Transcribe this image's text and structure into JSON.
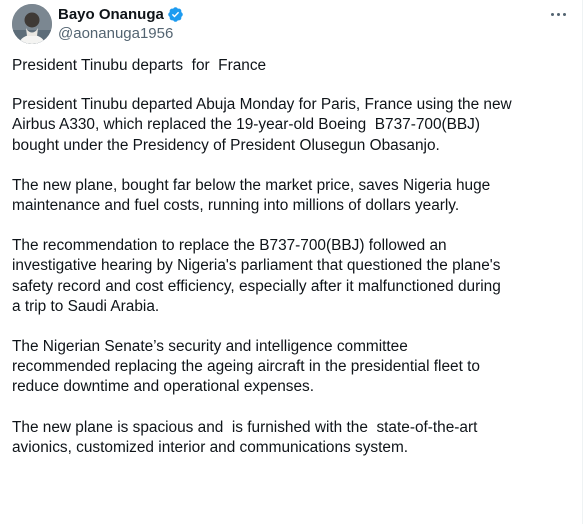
{
  "author": {
    "display_name": "Bayo Onanuga",
    "handle": "@aonanuga1956",
    "verified_color": "#1d9bf0"
  },
  "icons": {
    "verified": "verified-badge-icon",
    "more": "more-options-icon"
  },
  "post": {
    "title_line": "President Tinubu departs  for  France",
    "paragraphs": [
      "President Tinubu departed Abuja Monday for Paris, France using the new\nAirbus A330, which replaced the 19-year-old Boeing  B737-700(BBJ)\nbought under the Presidency of President Olusegun Obasanjo.",
      "The new plane, bought far below the market price, saves Nigeria huge\nmaintenance and fuel costs, running into millions of dollars yearly.",
      "The recommendation to replace the B737-700(BBJ) followed an\ninvestigative hearing by Nigeria's parliament that questioned the plane's\nsafety record and cost efficiency, especially after it malfunctioned during\na trip to Saudi Arabia.",
      "The Nigerian Senate’s security and intelligence committee\nrecommended replacing the ageing aircraft in the presidential fleet to\nreduce downtime and operational expenses.",
      "The new plane is spacious and  is furnished with the  state-of-the-art\navionics, customized interior and communications system."
    ]
  }
}
